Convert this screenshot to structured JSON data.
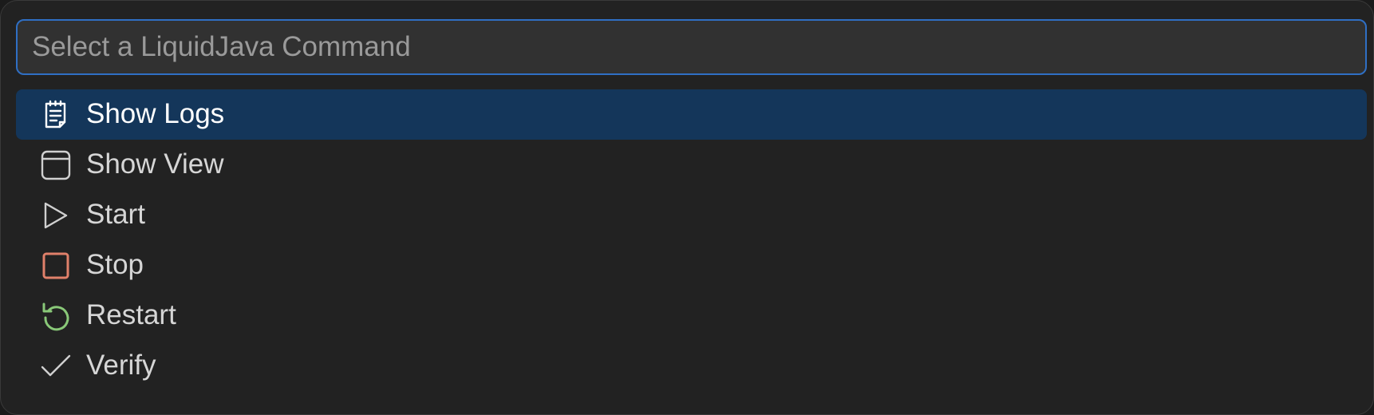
{
  "search": {
    "placeholder": "Select a LiquidJava Command",
    "value": ""
  },
  "colors": {
    "accent": "#2f6fc4",
    "selected_background": "#14365a",
    "stop_icon": "#e0806a",
    "restart_icon": "#89c878"
  },
  "commands": [
    {
      "label": "Show Logs",
      "icon": "output-log-icon",
      "selected": true
    },
    {
      "label": "Show View",
      "icon": "window-icon",
      "selected": false
    },
    {
      "label": "Start",
      "icon": "play-icon",
      "selected": false
    },
    {
      "label": "Stop",
      "icon": "stop-icon",
      "selected": false
    },
    {
      "label": "Restart",
      "icon": "restart-icon",
      "selected": false
    },
    {
      "label": "Verify",
      "icon": "check-icon",
      "selected": false
    }
  ]
}
